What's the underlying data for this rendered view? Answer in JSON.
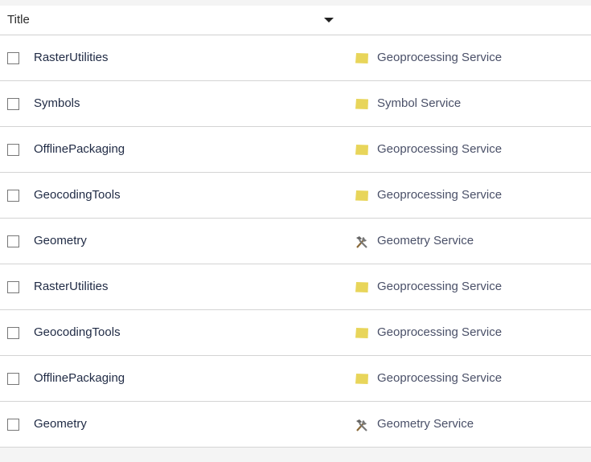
{
  "header": {
    "title_column": "Title"
  },
  "rows": [
    {
      "title": "RasterUtilities",
      "type": "Geoprocessing Service",
      "icon": "folder-icon"
    },
    {
      "title": "Symbols",
      "type": "Symbol Service",
      "icon": "folder-icon"
    },
    {
      "title": "OfflinePackaging",
      "type": "Geoprocessing Service",
      "icon": "folder-icon"
    },
    {
      "title": "GeocodingTools",
      "type": "Geoprocessing Service",
      "icon": "folder-icon"
    },
    {
      "title": "Geometry",
      "type": "Geometry Service",
      "icon": "tools-icon"
    },
    {
      "title": "RasterUtilities",
      "type": "Geoprocessing Service",
      "icon": "folder-icon"
    },
    {
      "title": "GeocodingTools",
      "type": "Geoprocessing Service",
      "icon": "folder-icon"
    },
    {
      "title": "OfflinePackaging",
      "type": "Geoprocessing Service",
      "icon": "folder-icon"
    },
    {
      "title": "Geometry",
      "type": "Geometry Service",
      "icon": "tools-icon"
    }
  ],
  "colors": {
    "folder": "#e8d55a",
    "text": "#1f2a44"
  }
}
